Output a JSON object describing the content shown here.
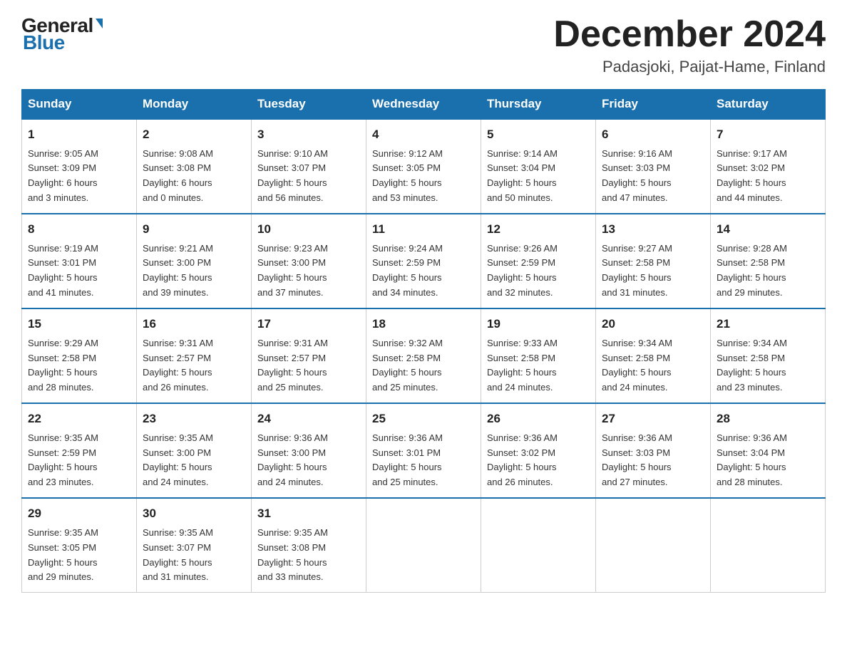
{
  "logo": {
    "general": "General",
    "blue": "Blue"
  },
  "title": "December 2024",
  "location": "Padasjoki, Paijat-Hame, Finland",
  "days_of_week": [
    "Sunday",
    "Monday",
    "Tuesday",
    "Wednesday",
    "Thursday",
    "Friday",
    "Saturday"
  ],
  "weeks": [
    [
      {
        "day": "1",
        "info": "Sunrise: 9:05 AM\nSunset: 3:09 PM\nDaylight: 6 hours\nand 3 minutes."
      },
      {
        "day": "2",
        "info": "Sunrise: 9:08 AM\nSunset: 3:08 PM\nDaylight: 6 hours\nand 0 minutes."
      },
      {
        "day": "3",
        "info": "Sunrise: 9:10 AM\nSunset: 3:07 PM\nDaylight: 5 hours\nand 56 minutes."
      },
      {
        "day": "4",
        "info": "Sunrise: 9:12 AM\nSunset: 3:05 PM\nDaylight: 5 hours\nand 53 minutes."
      },
      {
        "day": "5",
        "info": "Sunrise: 9:14 AM\nSunset: 3:04 PM\nDaylight: 5 hours\nand 50 minutes."
      },
      {
        "day": "6",
        "info": "Sunrise: 9:16 AM\nSunset: 3:03 PM\nDaylight: 5 hours\nand 47 minutes."
      },
      {
        "day": "7",
        "info": "Sunrise: 9:17 AM\nSunset: 3:02 PM\nDaylight: 5 hours\nand 44 minutes."
      }
    ],
    [
      {
        "day": "8",
        "info": "Sunrise: 9:19 AM\nSunset: 3:01 PM\nDaylight: 5 hours\nand 41 minutes."
      },
      {
        "day": "9",
        "info": "Sunrise: 9:21 AM\nSunset: 3:00 PM\nDaylight: 5 hours\nand 39 minutes."
      },
      {
        "day": "10",
        "info": "Sunrise: 9:23 AM\nSunset: 3:00 PM\nDaylight: 5 hours\nand 37 minutes."
      },
      {
        "day": "11",
        "info": "Sunrise: 9:24 AM\nSunset: 2:59 PM\nDaylight: 5 hours\nand 34 minutes."
      },
      {
        "day": "12",
        "info": "Sunrise: 9:26 AM\nSunset: 2:59 PM\nDaylight: 5 hours\nand 32 minutes."
      },
      {
        "day": "13",
        "info": "Sunrise: 9:27 AM\nSunset: 2:58 PM\nDaylight: 5 hours\nand 31 minutes."
      },
      {
        "day": "14",
        "info": "Sunrise: 9:28 AM\nSunset: 2:58 PM\nDaylight: 5 hours\nand 29 minutes."
      }
    ],
    [
      {
        "day": "15",
        "info": "Sunrise: 9:29 AM\nSunset: 2:58 PM\nDaylight: 5 hours\nand 28 minutes."
      },
      {
        "day": "16",
        "info": "Sunrise: 9:31 AM\nSunset: 2:57 PM\nDaylight: 5 hours\nand 26 minutes."
      },
      {
        "day": "17",
        "info": "Sunrise: 9:31 AM\nSunset: 2:57 PM\nDaylight: 5 hours\nand 25 minutes."
      },
      {
        "day": "18",
        "info": "Sunrise: 9:32 AM\nSunset: 2:58 PM\nDaylight: 5 hours\nand 25 minutes."
      },
      {
        "day": "19",
        "info": "Sunrise: 9:33 AM\nSunset: 2:58 PM\nDaylight: 5 hours\nand 24 minutes."
      },
      {
        "day": "20",
        "info": "Sunrise: 9:34 AM\nSunset: 2:58 PM\nDaylight: 5 hours\nand 24 minutes."
      },
      {
        "day": "21",
        "info": "Sunrise: 9:34 AM\nSunset: 2:58 PM\nDaylight: 5 hours\nand 23 minutes."
      }
    ],
    [
      {
        "day": "22",
        "info": "Sunrise: 9:35 AM\nSunset: 2:59 PM\nDaylight: 5 hours\nand 23 minutes."
      },
      {
        "day": "23",
        "info": "Sunrise: 9:35 AM\nSunset: 3:00 PM\nDaylight: 5 hours\nand 24 minutes."
      },
      {
        "day": "24",
        "info": "Sunrise: 9:36 AM\nSunset: 3:00 PM\nDaylight: 5 hours\nand 24 minutes."
      },
      {
        "day": "25",
        "info": "Sunrise: 9:36 AM\nSunset: 3:01 PM\nDaylight: 5 hours\nand 25 minutes."
      },
      {
        "day": "26",
        "info": "Sunrise: 9:36 AM\nSunset: 3:02 PM\nDaylight: 5 hours\nand 26 minutes."
      },
      {
        "day": "27",
        "info": "Sunrise: 9:36 AM\nSunset: 3:03 PM\nDaylight: 5 hours\nand 27 minutes."
      },
      {
        "day": "28",
        "info": "Sunrise: 9:36 AM\nSunset: 3:04 PM\nDaylight: 5 hours\nand 28 minutes."
      }
    ],
    [
      {
        "day": "29",
        "info": "Sunrise: 9:35 AM\nSunset: 3:05 PM\nDaylight: 5 hours\nand 29 minutes."
      },
      {
        "day": "30",
        "info": "Sunrise: 9:35 AM\nSunset: 3:07 PM\nDaylight: 5 hours\nand 31 minutes."
      },
      {
        "day": "31",
        "info": "Sunrise: 9:35 AM\nSunset: 3:08 PM\nDaylight: 5 hours\nand 33 minutes."
      },
      {
        "day": "",
        "info": ""
      },
      {
        "day": "",
        "info": ""
      },
      {
        "day": "",
        "info": ""
      },
      {
        "day": "",
        "info": ""
      }
    ]
  ]
}
